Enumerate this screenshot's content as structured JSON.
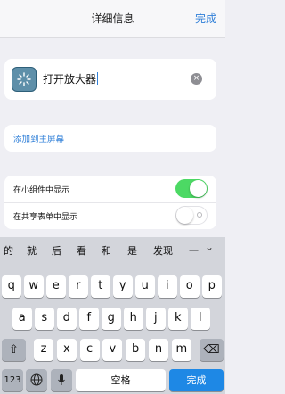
{
  "nav": {
    "title": "详细信息",
    "done": "完成"
  },
  "shortcut": {
    "name": "打开放大器",
    "clear": "×"
  },
  "add_home": "添加到主屏幕",
  "toggles": [
    {
      "label": "在小组件中显示",
      "on": true
    },
    {
      "label": "在共享表单中显示",
      "on": false
    }
  ],
  "candidates": [
    "的",
    "就",
    "后",
    "看",
    "和",
    "是",
    "发现",
    "一"
  ],
  "keyboard": {
    "row1": [
      "q",
      "w",
      "e",
      "r",
      "t",
      "y",
      "u",
      "i",
      "o",
      "p"
    ],
    "row2": [
      "a",
      "s",
      "d",
      "f",
      "g",
      "h",
      "j",
      "k",
      "l"
    ],
    "row3": [
      "z",
      "x",
      "c",
      "v",
      "b",
      "n",
      "m"
    ],
    "shift_icon": "⇧",
    "delete_icon": "⌫",
    "numbers": "123",
    "globe_icon": "⊕",
    "mic_icon": "mic",
    "space": "空格",
    "done": "完成"
  },
  "colors": {
    "accent": "#2f7fd8",
    "toggle_on": "#4cd964",
    "done_key": "#1e88e5"
  }
}
